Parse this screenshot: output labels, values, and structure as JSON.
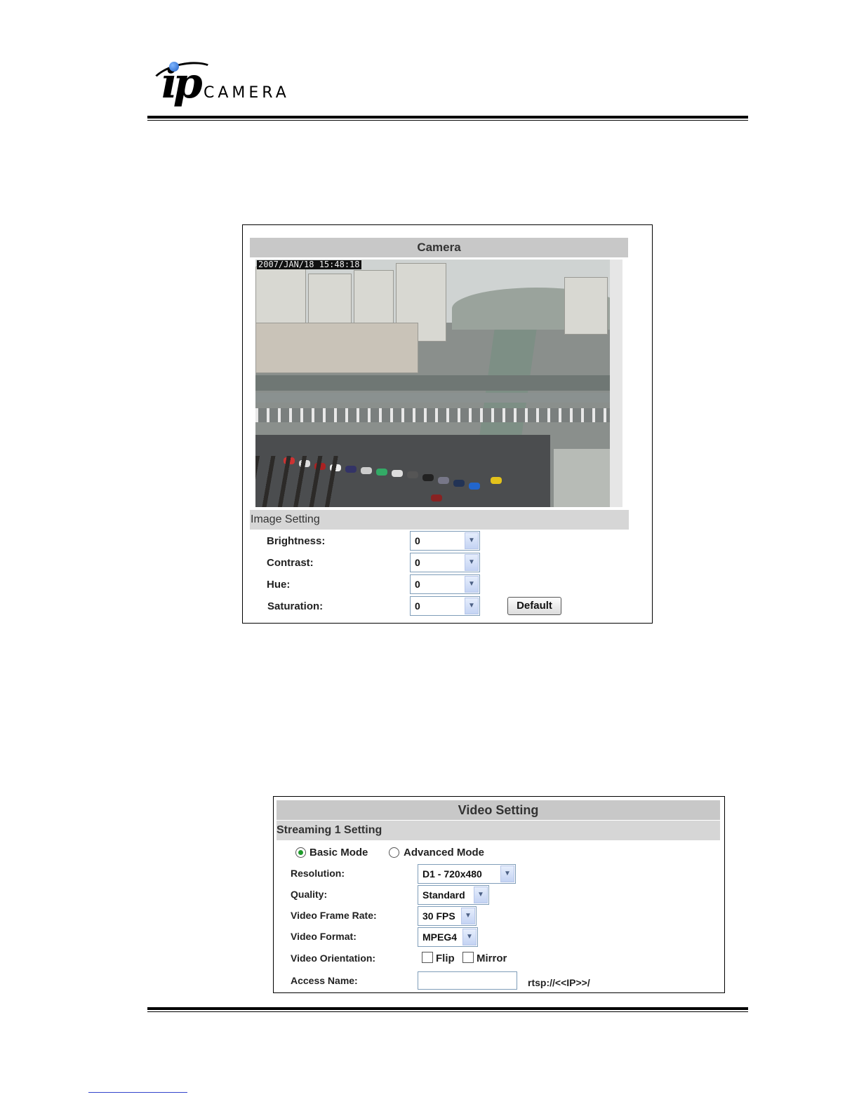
{
  "header": {
    "logo_ip": "ip",
    "logo_camera": "CAMERA"
  },
  "camera_panel": {
    "title": "Camera",
    "osd_timestamp": "2007/JAN/18 15:48:18",
    "image_setting_title": "Image Setting",
    "fields": [
      {
        "label": "Brightness:",
        "value": "0"
      },
      {
        "label": "Contrast:",
        "value": "0"
      },
      {
        "label": "Hue:",
        "value": "0"
      },
      {
        "label": "Saturation:",
        "value": "0"
      }
    ],
    "default_button": "Default"
  },
  "video_panel": {
    "title": "Video Setting",
    "streaming_title": "Streaming 1 Setting",
    "mode_basic": "Basic Mode",
    "mode_advanced": "Advanced Mode",
    "selected_mode": "Basic Mode",
    "resolution_label": "Resolution:",
    "resolution_value": "D1 - 720x480",
    "quality_label": "Quality:",
    "quality_value": "Standard",
    "frame_rate_label": "Video Frame Rate:",
    "frame_rate_value": "30 FPS",
    "format_label": "Video Format:",
    "format_value": "MPEG4",
    "orientation_label": "Video Orientation:",
    "flip_label": "Flip",
    "mirror_label": "Mirror",
    "access_name_label": "Access Name:",
    "access_name_value": "",
    "rtsp_prefix": "rtsp://<<IP>>/"
  },
  "colors": {
    "bar_gray": "#c8c8c8",
    "section_gray": "#d6d6d6",
    "radio_selected": "#1e9a2a",
    "select_border": "#7f9db9"
  }
}
